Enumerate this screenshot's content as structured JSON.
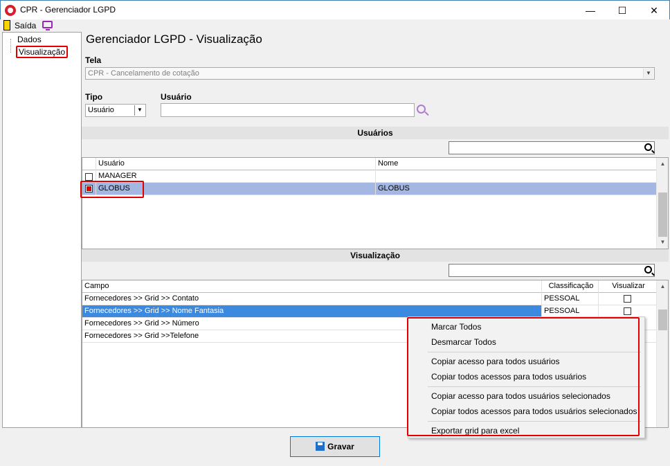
{
  "window": {
    "title": "CPR - Gerenciador LGPD",
    "minimize": "—",
    "maximize": "☐",
    "close": "✕"
  },
  "toolbar": {
    "exit_label": "Saída"
  },
  "tree": {
    "items": [
      {
        "label": "Dados"
      },
      {
        "label": "Visualização"
      }
    ]
  },
  "main": {
    "title": "Gerenciador LGPD - Visualização",
    "tela_label": "Tela",
    "tela_value": "CPR - Cancelamento de cotação",
    "tipo_label": "Tipo",
    "tipo_value": "Usuário",
    "usuario_label": "Usuário",
    "usuario_value": ""
  },
  "users_section": {
    "header": "Usuários",
    "columns": [
      "Usuário",
      "Nome"
    ],
    "rows": [
      {
        "usuario": "MANAGER",
        "nome": "",
        "checked": false
      },
      {
        "usuario": "GLOBUS",
        "nome": "GLOBUS",
        "checked": true
      }
    ]
  },
  "view_section": {
    "header": "Visualização",
    "columns": [
      "Campo",
      "Classificação",
      "Visualizar"
    ],
    "rows": [
      {
        "campo": "Fornecedores >> Grid >> Contato",
        "classificacao": "PESSOAL"
      },
      {
        "campo": "Fornecedores >> Grid >> Nome Fantasia",
        "classificacao": "PESSOAL"
      },
      {
        "campo": "Fornecedores >> Grid >> Número",
        "classificacao": ""
      },
      {
        "campo": "Fornecedores >> Grid >>Telefone",
        "classificacao": ""
      }
    ]
  },
  "context_menu": {
    "items": [
      "Marcar Todos",
      "Desmarcar Todos",
      "Copiar acesso para todos usuários",
      "Copiar todos acessos para todos usuários",
      "Copiar acesso para todos usuários selecionados",
      "Copiar todos acessos para todos usuários selecionados",
      "Exportar grid para excel"
    ]
  },
  "buttons": {
    "save": "Gravar"
  },
  "colors": {
    "highlight": "#e00000",
    "selection": "#a3b7e2",
    "row_blue": "#3c8ae0"
  }
}
